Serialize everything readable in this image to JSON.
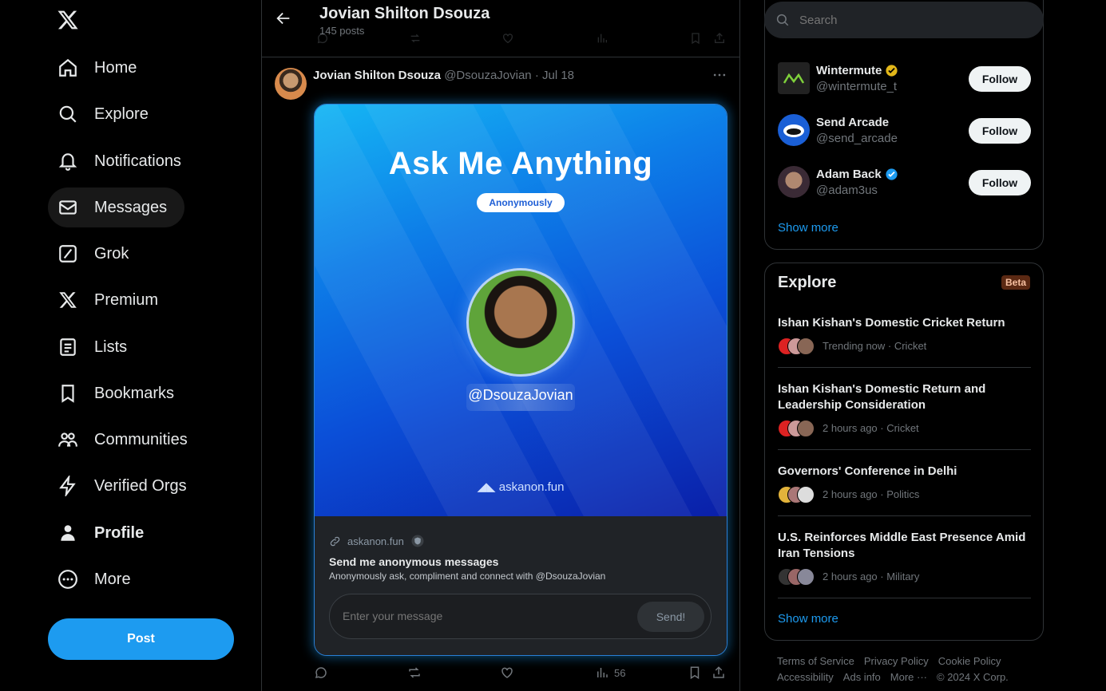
{
  "nav": {
    "items": [
      {
        "label": "Home",
        "icon": "home-icon"
      },
      {
        "label": "Explore",
        "icon": "search-icon"
      },
      {
        "label": "Notifications",
        "icon": "bell-icon"
      },
      {
        "label": "Messages",
        "icon": "mail-icon"
      },
      {
        "label": "Grok",
        "icon": "grok-icon"
      },
      {
        "label": "Premium",
        "icon": "x-logo-icon"
      },
      {
        "label": "Lists",
        "icon": "list-icon"
      },
      {
        "label": "Bookmarks",
        "icon": "bookmark-icon"
      },
      {
        "label": "Communities",
        "icon": "people-icon"
      },
      {
        "label": "Verified Orgs",
        "icon": "lightning-icon"
      },
      {
        "label": "Profile",
        "icon": "person-icon"
      },
      {
        "label": "More",
        "icon": "more-circle-icon"
      }
    ],
    "post_label": "Post"
  },
  "header": {
    "name": "Jovian Shilton Dsouza",
    "posts": "145 posts"
  },
  "tweet": {
    "name": "Jovian Shilton Dsouza",
    "handle": "@DsouzaJovian",
    "date": "· Jul 18",
    "image": {
      "title": "Ask Me Anything",
      "pill": "Anonymously",
      "handle": "@DsouzaJovian",
      "brand": "askanon.fun"
    },
    "card": {
      "domain": "askanon.fun",
      "title": "Send me anonymous messages",
      "description": "Anonymously ask, compliment and connect with @DsouzaJovian",
      "input_placeholder": "Enter your message",
      "send_label": "Send!"
    },
    "actions": {
      "views": "56"
    }
  },
  "search": {
    "placeholder": "Search"
  },
  "who_to_follow": [
    {
      "name": "Wintermute",
      "handle": "@wintermute_t",
      "verified": "gold",
      "follow": "Follow"
    },
    {
      "name": "Send Arcade",
      "handle": "@send_arcade",
      "verified": "",
      "follow": "Follow"
    },
    {
      "name": "Adam Back",
      "handle": "@adam3us",
      "verified": "blue",
      "follow": "Follow"
    }
  ],
  "wtf_show_more": "Show more",
  "explore": {
    "title": "Explore",
    "badge": "Beta",
    "items": [
      {
        "headline": "Ishan Kishan's Domestic Cricket Return",
        "meta": "Trending now · Cricket"
      },
      {
        "headline": "Ishan Kishan's Domestic Return and Leadership Consideration",
        "meta": "2 hours ago · Cricket"
      },
      {
        "headline": "Governors' Conference in Delhi",
        "meta": "2 hours ago · Politics"
      },
      {
        "headline": "U.S. Reinforces Middle East Presence Amid Iran Tensions",
        "meta": "2 hours ago · Military"
      }
    ],
    "show_more": "Show more"
  },
  "footer": {
    "links": [
      "Terms of Service",
      "Privacy Policy",
      "Cookie Policy",
      "Accessibility",
      "Ads info",
      "More ···",
      "© 2024 X Corp."
    ]
  },
  "colors": {
    "accent": "#1d9bf0",
    "background": "#000000",
    "gold_check": "#e2b719",
    "blue_check": "#1d9bf0"
  }
}
